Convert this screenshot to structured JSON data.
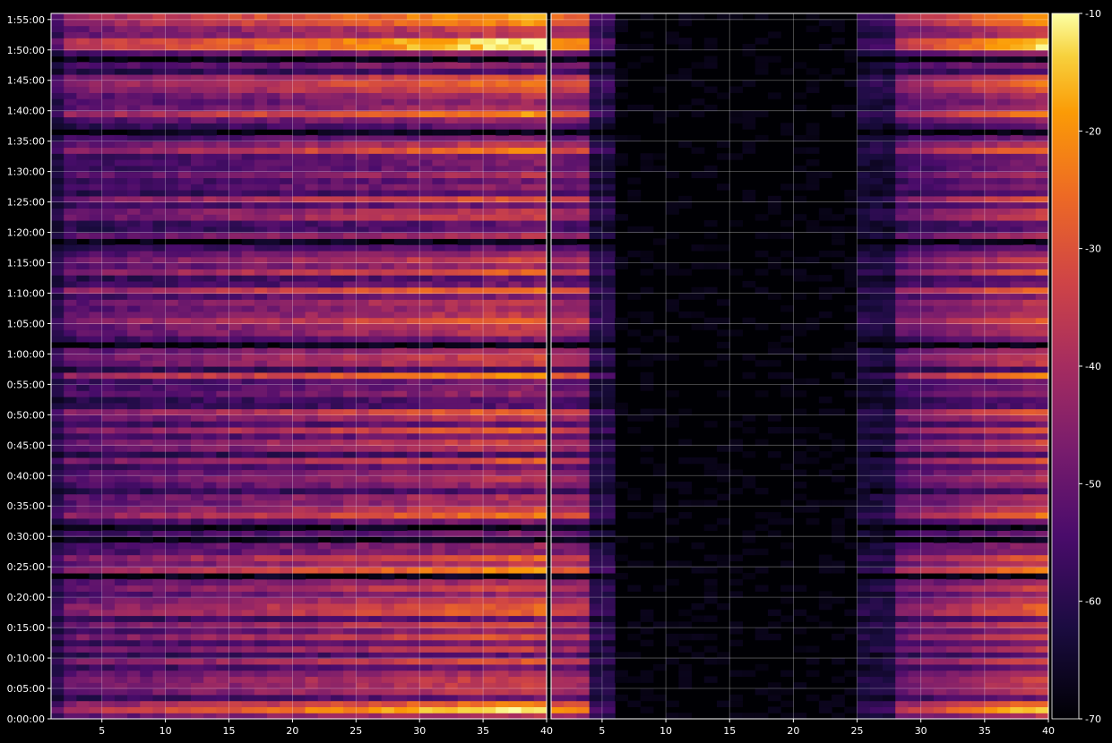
{
  "chart_data": {
    "type": "heatmap",
    "title": "",
    "xlabel": "",
    "ylabel": "",
    "colormap": "inferno",
    "background": "#000000",
    "grid": true,
    "panels": [
      {
        "x_range": [
          1,
          40
        ],
        "x_ticks": [
          5,
          10,
          15,
          20,
          25,
          30,
          35,
          40
        ],
        "description_level": "broadband energy across all x, strongest toward high x"
      },
      {
        "x_range": [
          1,
          40
        ],
        "x_ticks": [
          5,
          10,
          15,
          20,
          25,
          30,
          35,
          40
        ],
        "description_level": "energy concentrated at x≈1–4 and x≈27–40, near-empty middle"
      }
    ],
    "y_ticks": [
      "0:00:00",
      "0:05:00",
      "0:10:00",
      "0:15:00",
      "0:20:00",
      "0:25:00",
      "0:30:00",
      "0:35:00",
      "0:40:00",
      "0:45:00",
      "0:50:00",
      "0:55:00",
      "1:00:00",
      "1:05:00",
      "1:10:00",
      "1:15:00",
      "1:20:00",
      "1:25:00",
      "1:30:00",
      "1:35:00",
      "1:40:00",
      "1:45:00",
      "1:50:00",
      "1:55:00"
    ],
    "y_range_minutes": [
      0,
      116
    ],
    "colorbar": {
      "range": [
        -70,
        -10
      ],
      "ticks": [
        "-10",
        "-20",
        "-30",
        "-40",
        "-50",
        "-60",
        "-70"
      ]
    }
  }
}
